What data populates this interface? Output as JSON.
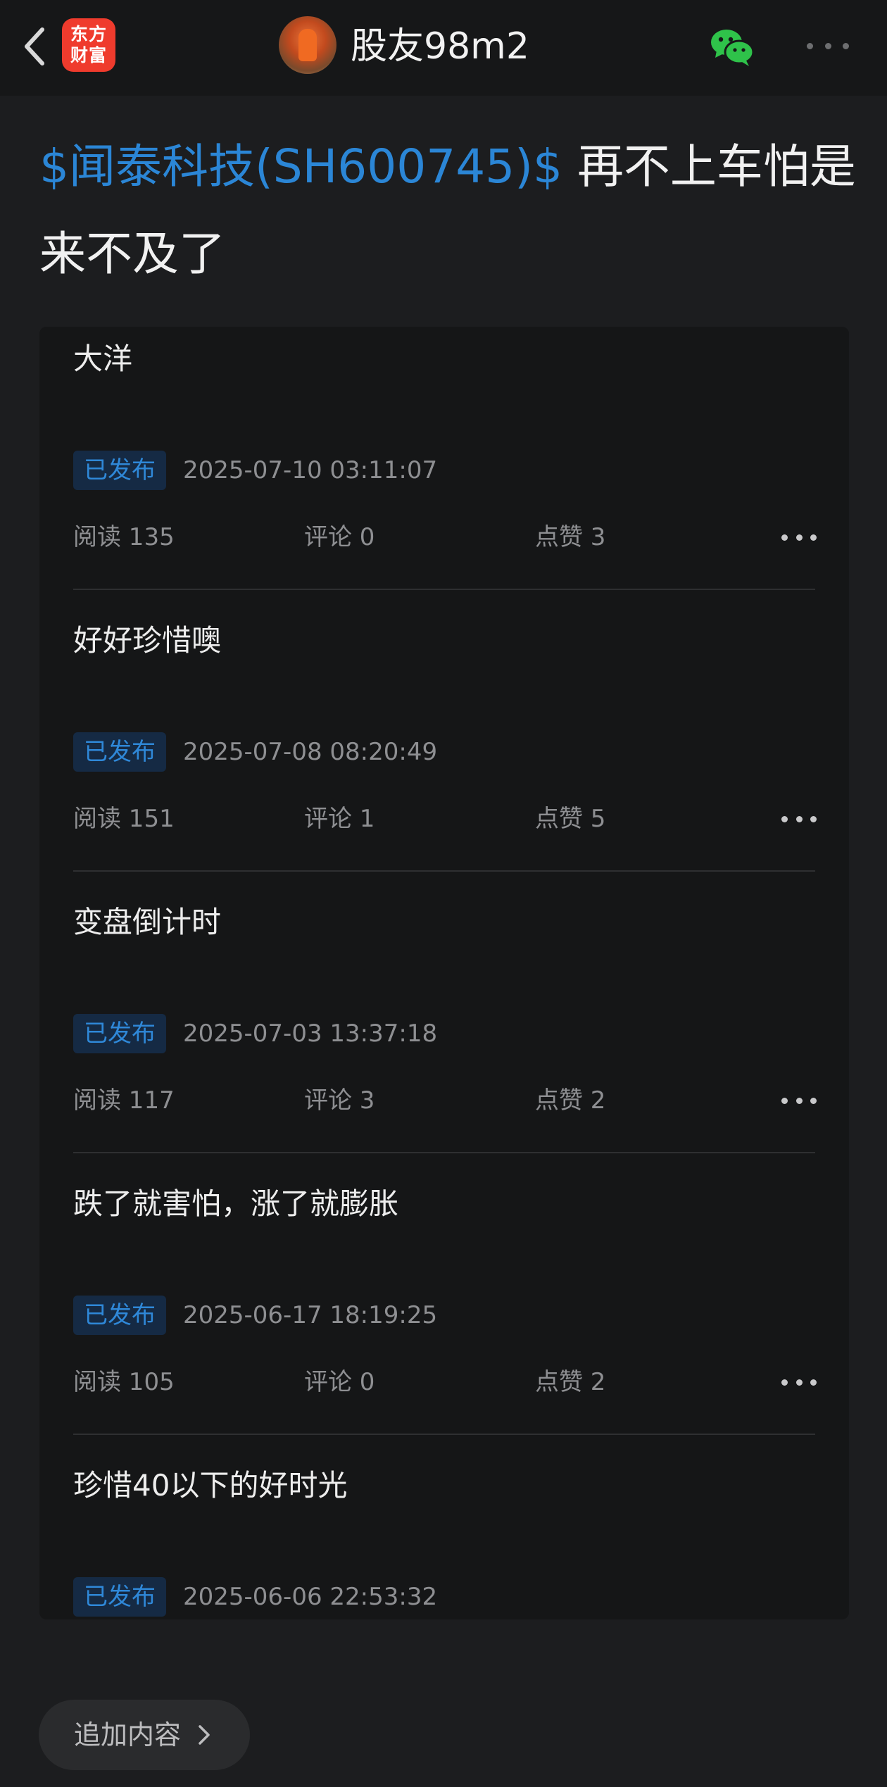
{
  "header": {
    "logo_lines": [
      "东方",
      "财富"
    ],
    "username": "股友98m2"
  },
  "post": {
    "stock_tag": "$闻泰科技(SH600745)$",
    "title_text": "再不上车怕是来不及了"
  },
  "entries": [
    {
      "title": "大洋",
      "status": "已发布",
      "date": "2025-07-10 03:11:07",
      "read": "阅读 135",
      "comment": "评论 0",
      "like": "点赞 3"
    },
    {
      "title": "好好珍惜噢",
      "status": "已发布",
      "date": "2025-07-08 08:20:49",
      "read": "阅读 151",
      "comment": "评论 1",
      "like": "点赞 5"
    },
    {
      "title": "变盘倒计时",
      "status": "已发布",
      "date": "2025-07-03 13:37:18",
      "read": "阅读 117",
      "comment": "评论 3",
      "like": "点赞 2"
    },
    {
      "title": "跌了就害怕，涨了就膨胀",
      "status": "已发布",
      "date": "2025-06-17 18:19:25",
      "read": "阅读 105",
      "comment": "评论 0",
      "like": "点赞 2"
    },
    {
      "title": "珍惜40以下的好时光",
      "status": "已发布",
      "date": "2025-06-06 22:53:32"
    }
  ],
  "footer": {
    "add_label": "追加内容"
  },
  "colors": {
    "accent": "#2b86d6",
    "badge_bg": "#152a44",
    "logo_red": "#ef3b2d",
    "wechat_green": "#2fc24a"
  },
  "icons": {
    "back": "chevron-left-icon",
    "share": "wechat-icon",
    "more": "more-dots-icon",
    "forward": "chevron-right-icon"
  }
}
